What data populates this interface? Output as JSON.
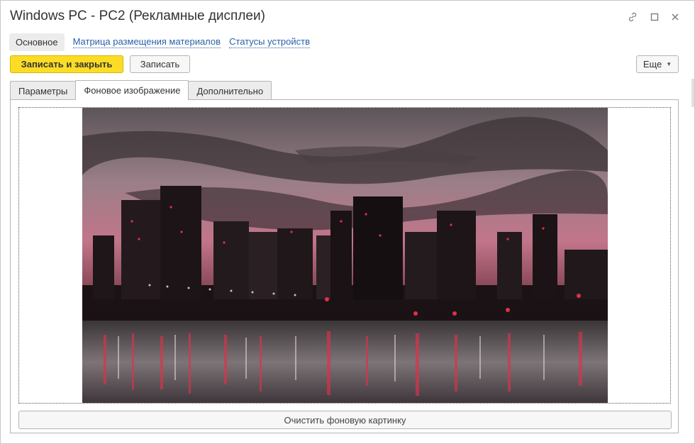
{
  "window": {
    "title": "Windows PC - PC2 (Рекламные дисплеи)"
  },
  "nav": {
    "items": [
      {
        "label": "Основное",
        "active": true
      },
      {
        "label": "Матрица размещения материалов",
        "active": false
      },
      {
        "label": "Статусы устройств",
        "active": false
      }
    ]
  },
  "toolbar": {
    "save_close_label": "Записать и закрыть",
    "save_label": "Записать",
    "more_label": "Еще"
  },
  "tabs": [
    {
      "label": "Параметры",
      "active": false
    },
    {
      "label": "Фоновое изображение",
      "active": true
    },
    {
      "label": "Дополнительно",
      "active": false
    }
  ],
  "panel": {
    "clear_button_label": "Очистить фоновую картинку"
  },
  "colors": {
    "primary_button": "#fcdc25",
    "link": "#2a5fa8",
    "accent_red": "#e0304a"
  }
}
